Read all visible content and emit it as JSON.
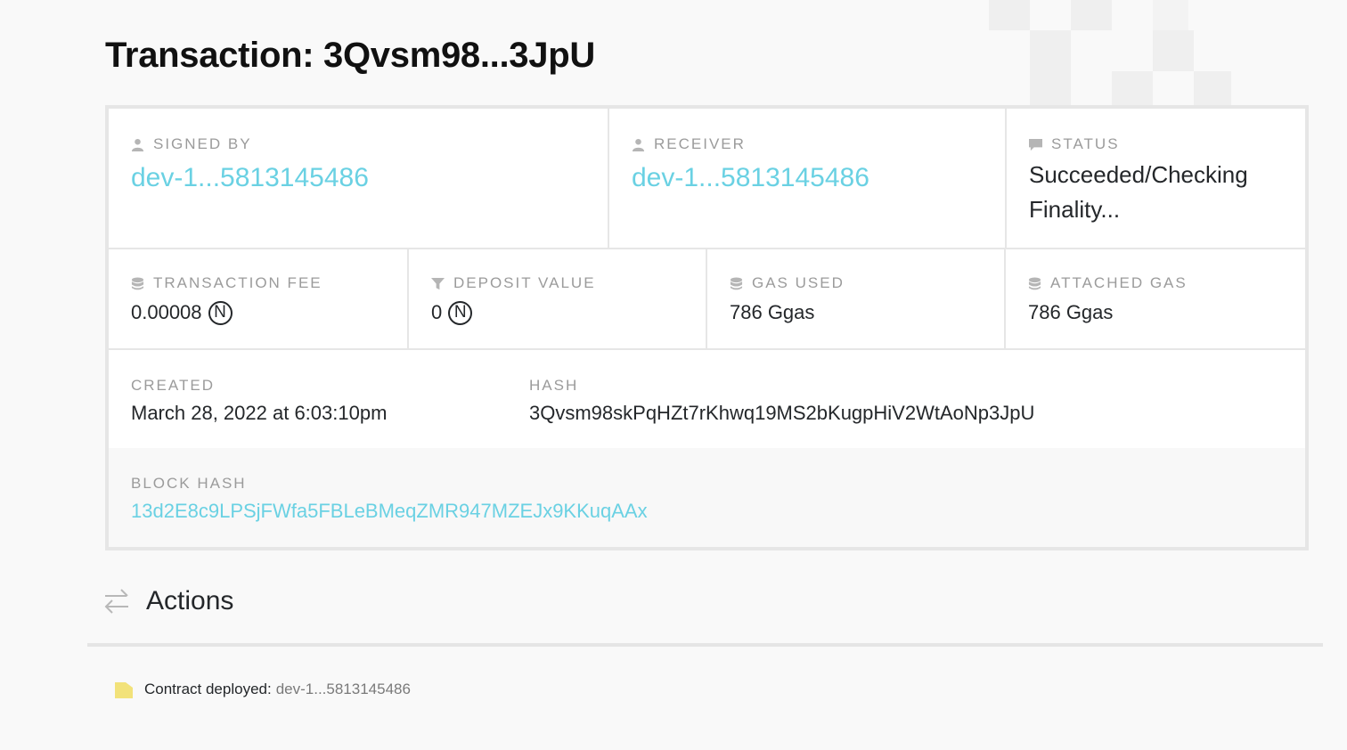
{
  "page": {
    "title": "Transaction: 3Qvsm98...3JpU"
  },
  "transaction": {
    "signed_by": {
      "label": "SIGNED BY",
      "value": "dev-1...5813145486",
      "icon": "user-icon"
    },
    "receiver": {
      "label": "RECEIVER",
      "value": "dev-1...5813145486",
      "icon": "user-icon"
    },
    "status": {
      "label": "STATUS",
      "value": "Succeeded/Checking Finality...",
      "icon": "comment-icon"
    },
    "transaction_fee": {
      "label": "TRANSACTION FEE",
      "value": "0.00008",
      "symbol": "N",
      "icon": "database-icon"
    },
    "deposit_value": {
      "label": "DEPOSIT VALUE",
      "value": "0",
      "symbol": "N",
      "icon": "filter-icon"
    },
    "gas_used": {
      "label": "GAS USED",
      "value": "786 Ggas",
      "icon": "database-icon"
    },
    "attached_gas": {
      "label": "ATTACHED GAS",
      "value": "786 Ggas",
      "icon": "database-icon"
    },
    "created": {
      "label": "CREATED",
      "value": "March 28, 2022 at 6:03:10pm"
    },
    "hash": {
      "label": "HASH",
      "value": "3Qvsm98skPqHZt7rKhwq19MS2bKugpHiV2WtAoNp3JpU"
    },
    "block_hash": {
      "label": "BLOCK HASH",
      "value": "13d2E8c9LPSjFWfa5FBLeBMeqZMR947MZEJx9KKuqAAx"
    }
  },
  "actions": {
    "title": "Actions",
    "icon": "swap-arrows-icon",
    "items": [
      {
        "prefix": "Contract deployed:",
        "account": "dev-1...5813145486",
        "icon": "file-icon"
      }
    ]
  },
  "colors": {
    "link": "#6ad1e3",
    "label": "#9b9b9b",
    "text": "#24272a",
    "background": "#f9f9f9",
    "border": "#e6e6e6",
    "block_hash_bg": "#f8f8f8"
  }
}
